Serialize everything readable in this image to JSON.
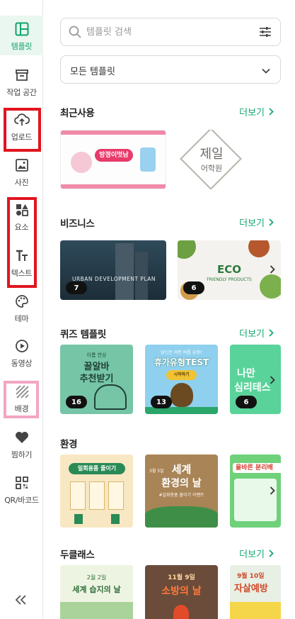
{
  "sidebar": {
    "items": [
      {
        "label": "템플릿",
        "icon": "template-icon"
      },
      {
        "label": "작업 공간",
        "icon": "workspace-icon"
      },
      {
        "label": "업로드",
        "icon": "upload-icon"
      },
      {
        "label": "사진",
        "icon": "photo-icon"
      },
      {
        "label": "요소",
        "icon": "elements-icon"
      },
      {
        "label": "텍스트",
        "icon": "text-icon"
      },
      {
        "label": "테마",
        "icon": "palette-icon"
      },
      {
        "label": "동영상",
        "icon": "video-icon"
      },
      {
        "label": "배경",
        "icon": "background-icon"
      },
      {
        "label": "찜하기",
        "icon": "heart-icon"
      },
      {
        "label": "QR/바코드",
        "icon": "qr-icon"
      }
    ],
    "collapse_icon": "double-chevron-left-icon"
  },
  "search": {
    "placeholder": "템플릿 검색"
  },
  "filter": {
    "selected": "모든 템플릿"
  },
  "more_label": "더보기",
  "sections": {
    "recent": {
      "title": "최근사용",
      "cards": [
        {
          "text": "방정이멋남"
        },
        {
          "text": "제일",
          "sub": "어학원"
        }
      ]
    },
    "business": {
      "title": "비즈니스",
      "cards": [
        {
          "badge": "7",
          "text": "URBAN DEVELOPMENT PLAN"
        },
        {
          "badge": "6",
          "text": "ECO",
          "sub": "FRIENDLY PRODUCTS"
        }
      ]
    },
    "quiz": {
      "title": "퀴즈 템플릿",
      "cards": [
        {
          "badge": "16",
          "pre": "이름 연상",
          "text": "꿀알바",
          "text2": "추천받기"
        },
        {
          "badge": "13",
          "pre": "당신은 어떤 여름 유형?",
          "text": "휴가유형TEST",
          "sub": "시작하기"
        },
        {
          "badge": "6",
          "text": "나만",
          "text2": "심리테스"
        }
      ]
    },
    "environment": {
      "title": "환경",
      "cards": [
        {
          "text": "일회용품 줄이기"
        },
        {
          "pre": "3월 5일",
          "text": "세계",
          "text2": "환경의 날",
          "sub": "#일회용품 줄이기 이벤트"
        },
        {
          "text": "올바른 분리배"
        }
      ]
    },
    "druglass": {
      "title": "두클래스",
      "cards": [
        {
          "pre": "2월 2일",
          "text": "세계 습지의 날"
        },
        {
          "pre": "11월 9일",
          "text": "소방의 날"
        },
        {
          "pre": "9월 10일",
          "text": "자살예방"
        }
      ]
    }
  },
  "colors": {
    "accent": "#14a86f",
    "highlight_red": "#e0151f",
    "highlight_pink": "#f3a5c3"
  }
}
